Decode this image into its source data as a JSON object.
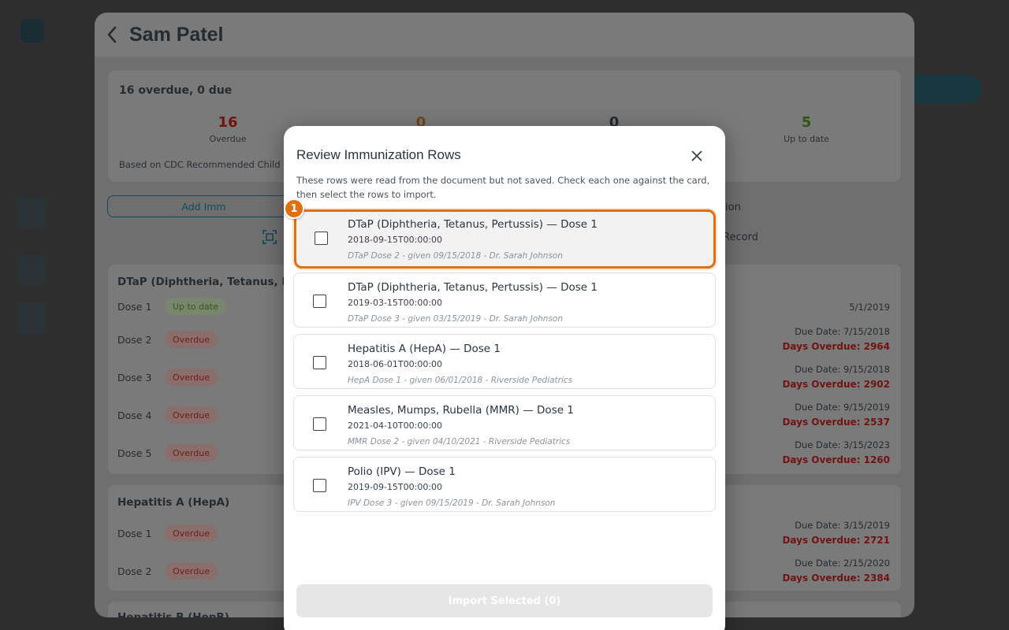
{
  "patient": {
    "name": "Sam Patel"
  },
  "summary": {
    "title": "16 overdue, 0 due",
    "stats": [
      {
        "value": "16",
        "label": "Overdue",
        "color": "#6f1411"
      },
      {
        "value": "0",
        "label": "",
        "color": "#6a4a1a"
      },
      {
        "value": "0",
        "label": "",
        "color": "#262b30"
      },
      {
        "value": "5",
        "label": "Up to date",
        "color": "#2f5416"
      }
    ],
    "note": "Based on CDC Recommended Child &"
  },
  "actions": {
    "add_label": "Add Imm",
    "right_label_1": "ion",
    "right_label_2": "Record"
  },
  "vaccines": [
    {
      "title": "DTaP (Diphtheria, Tetanus, Pert",
      "doses": [
        {
          "label": "Dose 1",
          "status": "Up to date",
          "due": "5/1/2019",
          "overdue": ""
        },
        {
          "label": "Dose 2",
          "status": "Overdue",
          "due": "Due Date: 7/15/2018",
          "overdue": "Days Overdue: 2964"
        },
        {
          "label": "Dose 3",
          "status": "Overdue",
          "due": "Due Date: 9/15/2018",
          "overdue": "Days Overdue: 2902"
        },
        {
          "label": "Dose 4",
          "status": "Overdue",
          "due": "Due Date: 9/15/2019",
          "overdue": "Days Overdue: 2537"
        },
        {
          "label": "Dose 5",
          "status": "Overdue",
          "due": "Due Date: 3/15/2023",
          "overdue": "Days Overdue: 1260"
        }
      ]
    },
    {
      "title": "Hepatitis A (HepA)",
      "doses": [
        {
          "label": "Dose 1",
          "status": "Overdue",
          "due": "Due Date: 3/15/2019",
          "overdue": "Days Overdue: 2721"
        },
        {
          "label": "Dose 2",
          "status": "Overdue",
          "due": "Due Date: 2/15/2020",
          "overdue": "Days Overdue: 2384"
        }
      ]
    },
    {
      "title": "Hepatitis B (HepB)"
    }
  ],
  "modal": {
    "title": "Review Immunization Rows",
    "description": "These rows were read from the document but not saved. Check each one against the card, then select the rows to import.",
    "focus_marker": "1",
    "rows": [
      {
        "title": "DTaP (Diphtheria, Tetanus, Pertussis) — Dose 1",
        "date": "2018-09-15T00:00:00",
        "source": "DTaP Dose 2 - given 09/15/2018 - Dr. Sarah Johnson",
        "checked": false
      },
      {
        "title": "DTaP (Diphtheria, Tetanus, Pertussis) — Dose 1",
        "date": "2019-03-15T00:00:00",
        "source": "DTaP Dose 3 - given 03/15/2019 - Dr. Sarah Johnson",
        "checked": false
      },
      {
        "title": "Hepatitis A (HepA) — Dose 1",
        "date": "2018-06-01T00:00:00",
        "source": "HepA Dose 1 - given 06/01/2018 - Riverside Pediatrics",
        "checked": false
      },
      {
        "title": "Measles, Mumps, Rubella (MMR) — Dose 1",
        "date": "2021-04-10T00:00:00",
        "source": "MMR Dose 2 - given 04/10/2021 - Riverside Pediatrics",
        "checked": false
      },
      {
        "title": "Polio (IPV) — Dose 1",
        "date": "2019-09-15T00:00:00",
        "source": "IPV Dose 3 - given 09/15/2019 - Dr. Sarah Johnson",
        "checked": false
      }
    ],
    "import_label": "Import Selected (0)",
    "accent_color": "#e0700f"
  }
}
